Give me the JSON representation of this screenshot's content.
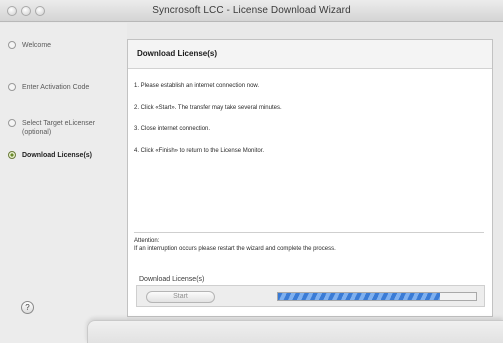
{
  "window": {
    "title": "Syncrosoft LCC - License Download Wizard"
  },
  "sidebar": {
    "steps": [
      {
        "label": "Welcome",
        "active": false
      },
      {
        "label": "Enter Activation Code",
        "active": false
      },
      {
        "label": "Select Target eLicenser (optional)",
        "active": false
      },
      {
        "label": "Download License(s)",
        "active": true
      }
    ],
    "help_glyph": "?"
  },
  "panel": {
    "title": "Download License(s)",
    "instructions": [
      "1.  Please establish an internet connection now.",
      "2.  Click «Start». The transfer may take several minutes.",
      "3.  Close internet connection.",
      "4.  Click «Finish» to return to the License Monitor."
    ],
    "attention_title": "Attention:",
    "attention_text": "If an interruption occurs please restart the wizard and complete the process."
  },
  "download": {
    "label": "Download License(s)",
    "start_label": "Start",
    "start_enabled": false,
    "progress": 0.82
  },
  "colors": {
    "progress_fill": "#3a7bd5",
    "active_step_bullet": "#6a8a2a"
  }
}
